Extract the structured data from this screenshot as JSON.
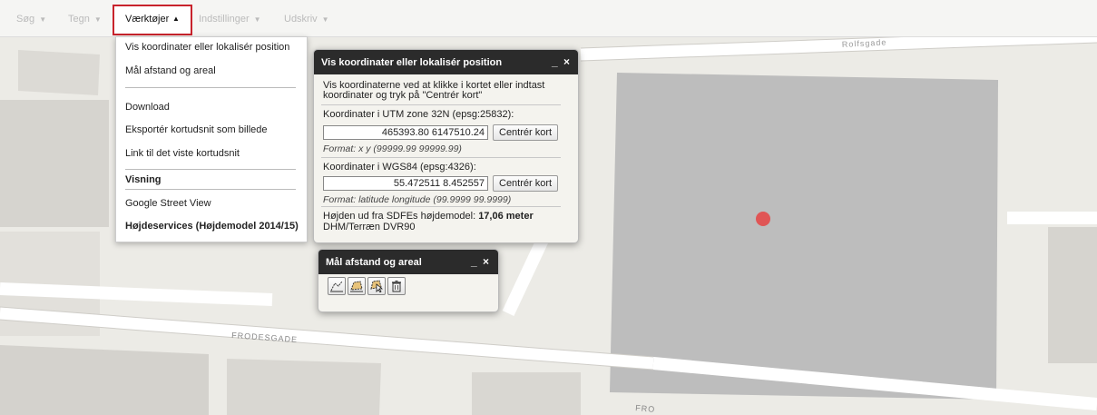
{
  "toolbar": {
    "items": [
      {
        "label": "Søg"
      },
      {
        "label": "Tegn"
      },
      {
        "label": "Værktøjer"
      },
      {
        "label": "Indstillinger"
      },
      {
        "label": "Udskriv"
      }
    ]
  },
  "dropdown": {
    "items": [
      "Vis koordinater eller lokalisér position",
      "Mål afstand og areal",
      "Download",
      "Eksportér kortudsnit som billede",
      "Link til det viste kortudsnit",
      "Visning",
      "Google Street View",
      "Højdeservices (Højdemodel 2014/15)"
    ]
  },
  "coord_panel": {
    "title": "Vis koordinater eller lokalisér position",
    "minimize": "_",
    "close": "×",
    "intro_line1": "Vis koordinaterne ved at klikke i kortet eller indtast",
    "intro_line2": "koordinater og tryk på \"Centrér kort\"",
    "utm_label": "Koordinater i UTM zone 32N (epsg:25832):",
    "utm_value": "465393.80 6147510.24",
    "utm_button": "Centrér kort",
    "utm_format": "Format: x y (99999.99 99999.99)",
    "wgs_label": "Koordinater i WGS84 (epsg:4326):",
    "wgs_value": "55.472511 8.452557",
    "wgs_button": "Centrér kort",
    "wgs_format": "Format: latitude longitude (99.9999 99.9999)",
    "height_prefix": "Højden ud fra SDFEs højdemodel: ",
    "height_value": "17,06 meter",
    "height_line2": "DHM/Terræn DVR90"
  },
  "measure_panel": {
    "title": "Mål afstand og areal",
    "minimize": "_",
    "close": "×"
  },
  "map": {
    "labels": [
      "FRODESGADE",
      "Rolfsgade",
      "FRO"
    ],
    "marker_color": "#e05555"
  },
  "icons": {
    "measure_line": "measure-distance-icon",
    "measure_area": "measure-area-icon",
    "select": "select-measure-icon",
    "delete": "trash-icon"
  }
}
